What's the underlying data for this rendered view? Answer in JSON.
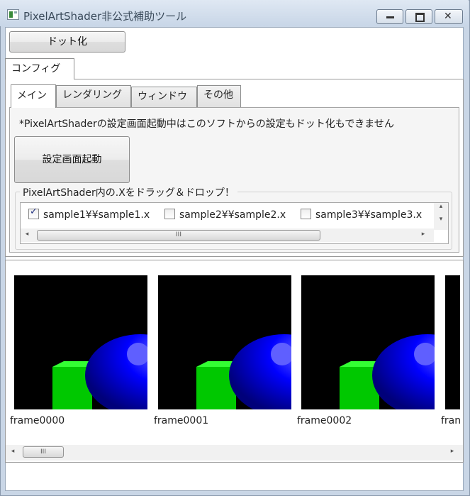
{
  "window": {
    "title": "PixelArtShader非公式補助ツール",
    "minimize_glyph": "▁",
    "maximize_glyph": "▣",
    "close_glyph": "✕"
  },
  "toolbar": {
    "dot_button_label": "ドット化"
  },
  "outer_tabs": [
    {
      "label": "コンフィグ"
    }
  ],
  "inner_tabs": [
    {
      "label": "メイン"
    },
    {
      "label": "レンダリング"
    },
    {
      "label": "ウィンドウ"
    },
    {
      "label": "その他"
    }
  ],
  "main": {
    "note": "*PixelArtShaderの設定画面起動中はこのソフトからの設定もドット化もできません",
    "launch_button_label": "設定画面起動",
    "drop_group_label": "PixelArtShader内の.Xをドラッグ＆ドロップ！",
    "files": [
      {
        "label": "sample1¥¥sample1.x",
        "checked": true
      },
      {
        "label": "sample2¥¥sample2.x",
        "checked": false
      },
      {
        "label": "sample3¥¥sample3.x",
        "checked": false
      }
    ]
  },
  "frames": [
    {
      "label": "frame0000"
    },
    {
      "label": "frame0001"
    },
    {
      "label": "frame0002"
    },
    {
      "label": "fran"
    }
  ],
  "scroll": {
    "thumb_glyph": "III",
    "left": "◂",
    "right": "▸",
    "up": "▴",
    "down": "▾"
  },
  "colors": {
    "sphere": "#0000ff",
    "cube": "#00c800",
    "background": "#000000"
  }
}
